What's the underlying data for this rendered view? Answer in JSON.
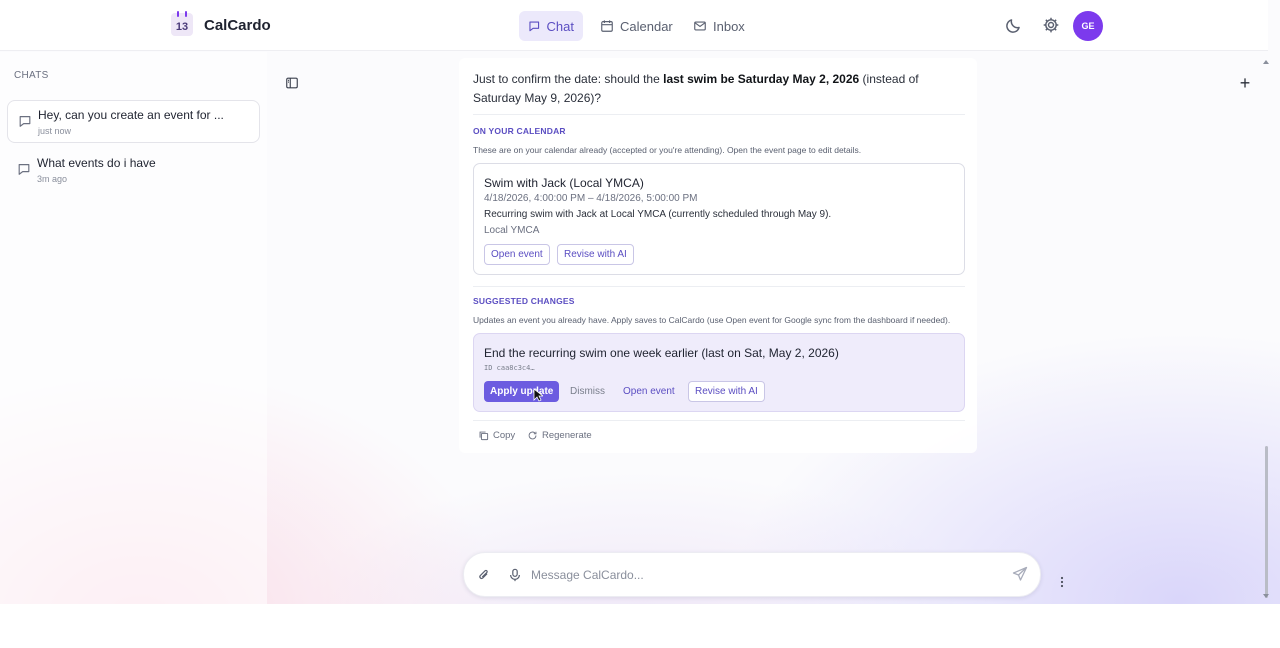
{
  "app": {
    "logo_number": "13",
    "name": "CalCardo"
  },
  "nav": {
    "chat": "Chat",
    "calendar": "Calendar",
    "inbox": "Inbox"
  },
  "user": {
    "initials": "GE"
  },
  "sidebar": {
    "title": "CHATS",
    "items": [
      {
        "title": "Hey, can you create an event for ...",
        "time": "just now"
      },
      {
        "title": "What events do i have",
        "time": "3m ago"
      }
    ]
  },
  "message": {
    "text_prefix": "Just to confirm the date: should the ",
    "text_bold": "last swim be Saturday May 2, 2026",
    "text_suffix": " (instead of Saturday May 9, 2026)?"
  },
  "on_calendar": {
    "label": "ON YOUR CALENDAR",
    "description": "These are on your calendar already (accepted or you're attending). Open the event page to edit details.",
    "event": {
      "title": "Swim with Jack (Local YMCA)",
      "time": "4/18/2026, 4:00:00 PM – 4/18/2026, 5:00:00 PM",
      "description": "Recurring swim with Jack at Local YMCA (currently scheduled through May 9).",
      "location": "Local YMCA",
      "open_label": "Open event",
      "revise_label": "Revise with AI"
    }
  },
  "suggested": {
    "label": "SUGGESTED CHANGES",
    "description": "Updates an event you already have. Apply saves to CalCardo (use Open event for Google sync from the dashboard if needed).",
    "change": {
      "title": "End the recurring swim one week earlier (last on Sat, May 2, 2026)",
      "id": "ID caa8c3c4…",
      "apply_label": "Apply update",
      "dismiss_label": "Dismiss",
      "open_label": "Open event",
      "revise_label": "Revise with AI"
    }
  },
  "actions": {
    "copy": "Copy",
    "regenerate": "Regenerate"
  },
  "composer": {
    "placeholder": "Message CalCardo..."
  },
  "colors": {
    "accent": "#6c5ce0",
    "avatar": "#7c3aed",
    "label": "#5b4ec2"
  }
}
